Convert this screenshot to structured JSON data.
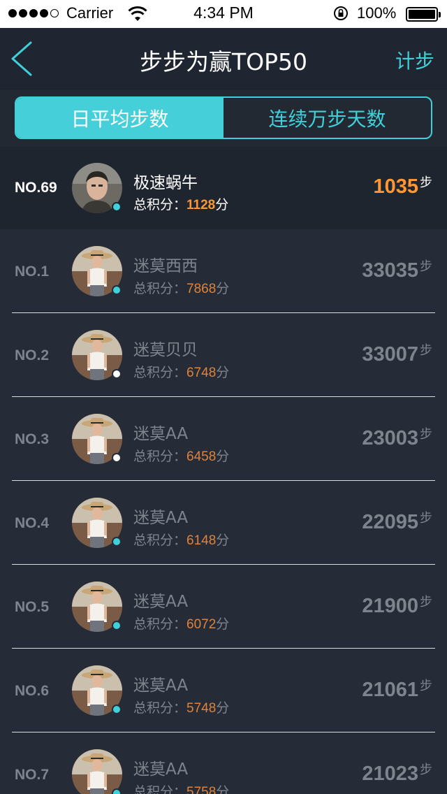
{
  "status_bar": {
    "carrier": "Carrier",
    "time": "4:34 PM",
    "battery": "100%"
  },
  "nav": {
    "title": "步步为赢TOP50",
    "right_action": "计步",
    "back_icon": "chevron-left-icon"
  },
  "tabs": [
    {
      "label": "日平均步数",
      "active": true
    },
    {
      "label": "连续万步天数",
      "active": false
    }
  ],
  "me": {
    "rank": "NO.69",
    "name": "极速蜗牛",
    "score_label": "总积分：",
    "score": "1128",
    "score_unit": "分",
    "steps": "1035",
    "steps_unit": "步",
    "online": true
  },
  "ranking": [
    {
      "rank": "NO.1",
      "name": "迷莫西西",
      "score_label": "总积分：",
      "score": "7868",
      "score_unit": "分",
      "steps": "33035",
      "steps_unit": "步",
      "online": true
    },
    {
      "rank": "NO.2",
      "name": "迷莫贝贝",
      "score_label": "总积分：",
      "score": "6748",
      "score_unit": "分",
      "steps": "33007",
      "steps_unit": "步",
      "online": false
    },
    {
      "rank": "NO.3",
      "name": "迷莫AA",
      "score_label": "总积分：",
      "score": "6458",
      "score_unit": "分",
      "steps": "23003",
      "steps_unit": "步",
      "online": false
    },
    {
      "rank": "NO.4",
      "name": "迷莫AA",
      "score_label": "总积分：",
      "score": "6148",
      "score_unit": "分",
      "steps": "22095",
      "steps_unit": "步",
      "online": true
    },
    {
      "rank": "NO.5",
      "name": "迷莫AA",
      "score_label": "总积分：",
      "score": "6072",
      "score_unit": "分",
      "steps": "21900",
      "steps_unit": "步",
      "online": true
    },
    {
      "rank": "NO.6",
      "name": "迷莫AA",
      "score_label": "总积分：",
      "score": "5748",
      "score_unit": "分",
      "steps": "21061",
      "steps_unit": "步",
      "online": true
    },
    {
      "rank": "NO.7",
      "name": "迷莫AA",
      "score_label": "总积分：",
      "score": "5758",
      "score_unit": "分",
      "steps": "21023",
      "steps_unit": "步",
      "online": true
    }
  ],
  "colors": {
    "accent": "#3fd0da",
    "highlight": "#ff9632",
    "online": "#3fd0da",
    "offline": "#ffffff"
  }
}
